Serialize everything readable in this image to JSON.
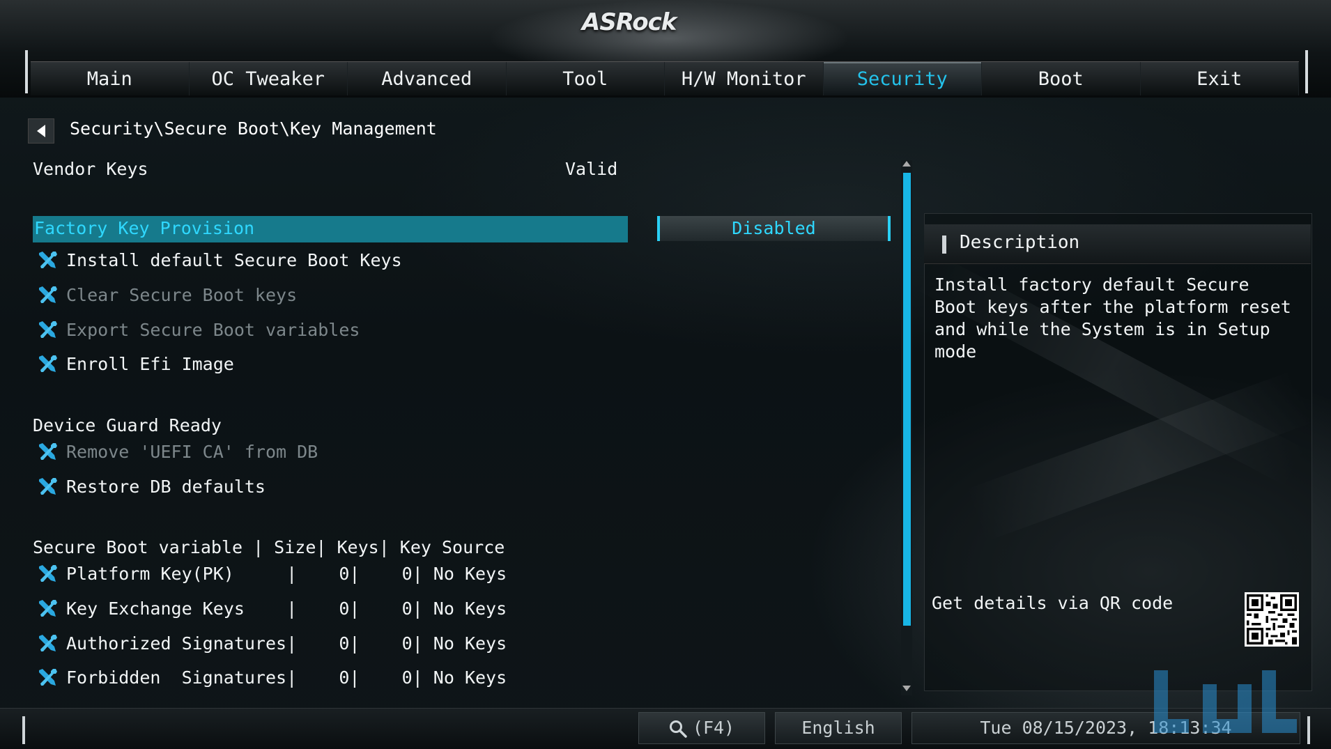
{
  "header": {
    "brand": "ASRock",
    "tabs": [
      {
        "label": "Main",
        "active": false
      },
      {
        "label": "OC Tweaker",
        "active": false
      },
      {
        "label": "Advanced",
        "active": false
      },
      {
        "label": "Tool",
        "active": false
      },
      {
        "label": "H/W Monitor",
        "active": false
      },
      {
        "label": "Security",
        "active": true
      },
      {
        "label": "Boot",
        "active": false
      },
      {
        "label": "Exit",
        "active": false
      }
    ]
  },
  "breadcrumb": "Security\\Secure Boot\\Key Management",
  "vendor_keys": {
    "label": "Vendor Keys",
    "value": "Valid"
  },
  "factory_key": {
    "label": "Factory Key Provision",
    "value": "Disabled"
  },
  "actions": [
    {
      "label": "Install default Secure Boot Keys",
      "enabled": true
    },
    {
      "label": "Clear Secure Boot keys",
      "enabled": false
    },
    {
      "label": "Export Secure Boot variables",
      "enabled": false
    },
    {
      "label": "Enroll Efi Image",
      "enabled": true
    }
  ],
  "device_guard": {
    "heading": "Device Guard Ready",
    "items": [
      {
        "label": "Remove 'UEFI CA' from DB",
        "enabled": false
      },
      {
        "label": "Restore DB defaults",
        "enabled": true
      }
    ]
  },
  "variables_table": {
    "header": "Secure Boot variable | Size| Keys| Key Source",
    "rows": [
      {
        "text": "Platform Key(PK)     |    0|    0| No Keys"
      },
      {
        "text": "Key Exchange Keys    |    0|    0| No Keys"
      },
      {
        "text": "Authorized Signatures|    0|    0| No Keys"
      },
      {
        "text": "Forbidden  Signatures|    0|    0| No Keys"
      }
    ]
  },
  "description": {
    "title": "Description",
    "text": "Install factory default Secure Boot keys after the platform reset and while the System is in Setup mode",
    "qr_label": "Get details via QR code"
  },
  "footer": {
    "search_label": "(F4)",
    "language": "English",
    "datetime": "Tue 08/15/2023, 18:13:34"
  },
  "colors": {
    "accent": "#24c3ec",
    "selection_bar": "#167a8c",
    "icon_blue": "#2aa8e0",
    "disabled_text": "#7d878b"
  },
  "icons": {
    "tool_item": "wrench-screwdriver-icon",
    "back": "back-arrow-icon",
    "search": "search-icon"
  }
}
